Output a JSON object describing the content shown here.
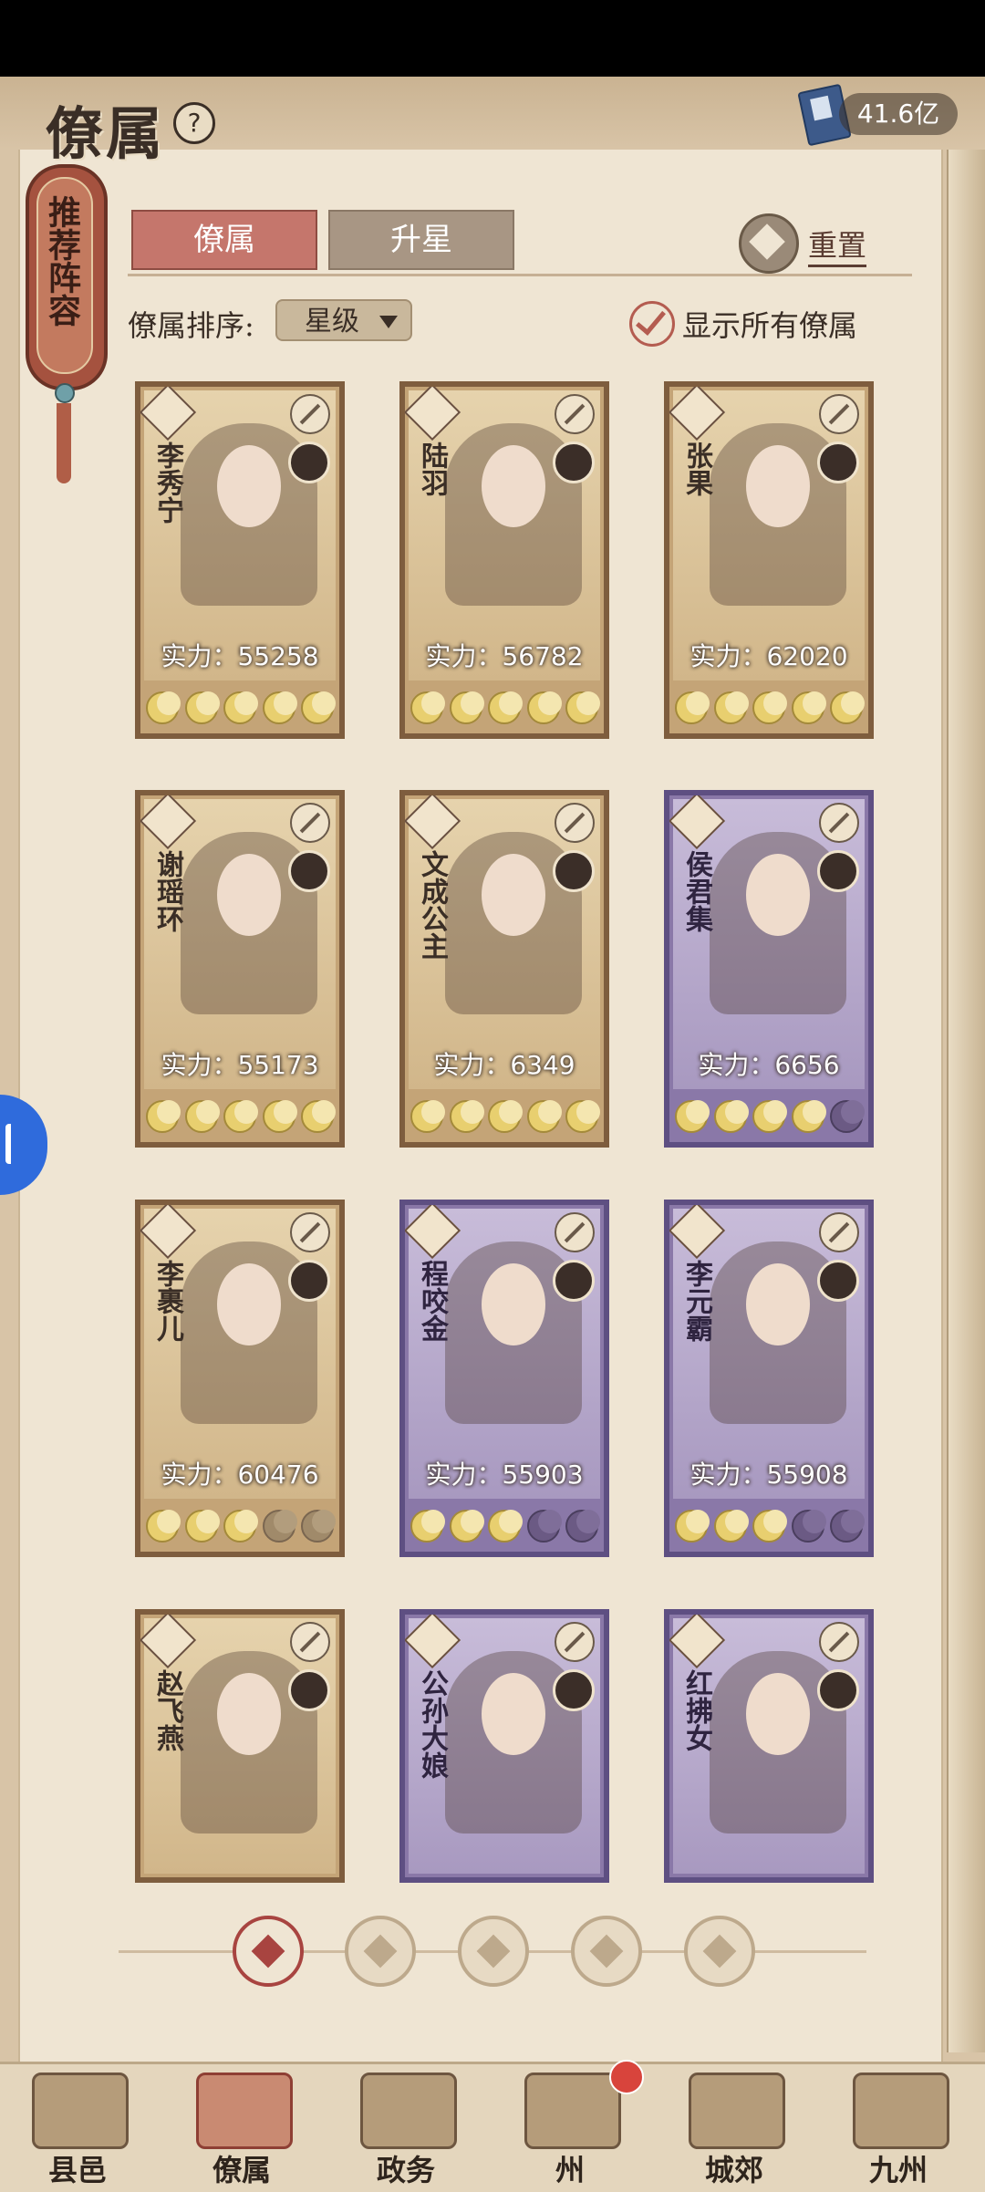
{
  "header": {
    "title": "僚属",
    "help_icon": "question-icon",
    "currency_icon": "book-icon",
    "currency_value": "41.6亿"
  },
  "side_tag": {
    "label": "推荐阵容"
  },
  "tabs": [
    {
      "label": "僚属",
      "active": true
    },
    {
      "label": "升星",
      "active": false
    }
  ],
  "reset": {
    "label": "重置",
    "icon": "reset-icon"
  },
  "sort": {
    "label": "僚属排序:",
    "value": "星级"
  },
  "show_all": {
    "label": "显示所有僚属",
    "checked": true
  },
  "cards": [
    {
      "name": "李秀宁",
      "power": "实力：55258",
      "rarity": "gold",
      "stars": 5
    },
    {
      "name": "陆羽",
      "power": "实力：56782",
      "rarity": "gold",
      "stars": 5
    },
    {
      "name": "张果",
      "power": "实力：62020",
      "rarity": "gold",
      "stars": 5
    },
    {
      "name": "谢瑶环",
      "power": "实力：55173",
      "rarity": "gold",
      "stars": 5
    },
    {
      "name": "文成公主",
      "power": "实力：6349",
      "rarity": "gold",
      "stars": 5
    },
    {
      "name": "侯君集",
      "power": "实力：6656",
      "rarity": "purple",
      "stars": 4
    },
    {
      "name": "李裹儿",
      "power": "实力：60476",
      "rarity": "gold",
      "stars": 3
    },
    {
      "name": "程咬金",
      "power": "实力：55903",
      "rarity": "purple",
      "stars": 3
    },
    {
      "name": "李元霸",
      "power": "实力：55908",
      "rarity": "purple",
      "stars": 3
    },
    {
      "name": "赵飞燕",
      "power": "",
      "rarity": "gold",
      "stars": 0
    },
    {
      "name": "公孙大娘",
      "power": "",
      "rarity": "purple",
      "stars": 0
    },
    {
      "name": "红拂女",
      "power": "",
      "rarity": "purple",
      "stars": 0
    }
  ],
  "filters": [
    "all-filter-icon",
    "helmet-filter-icon",
    "gourd-filter-icon",
    "fan-filter-icon",
    "beast-filter-icon"
  ],
  "nav": [
    {
      "label": "县邑",
      "active": false
    },
    {
      "label": "僚属",
      "active": true
    },
    {
      "label": "政务",
      "active": false
    },
    {
      "label": "州",
      "active": false
    },
    {
      "label": "城郊",
      "active": false
    },
    {
      "label": "九州",
      "active": false
    }
  ],
  "colors": {
    "accent": "#c5766c",
    "page": "#efe5d3",
    "gold_card": "#c4a477",
    "purple_card": "#8a78a8"
  }
}
